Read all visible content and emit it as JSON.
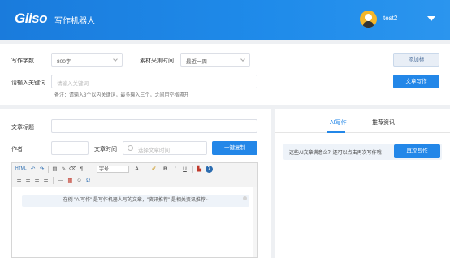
{
  "header": {
    "logo": "Giiso",
    "app_name": "写作机器人",
    "username": "test2"
  },
  "settings": {
    "word_count_label": "写作字数",
    "word_count_value": "800字",
    "time_label": "素材采集时间",
    "time_value": "最近一周",
    "keyword_label": "请输入关键词",
    "keyword_placeholder": "请输入关键词",
    "note": "备注：请输入3个以内关键词，最多输入三个，之间用空格隔开",
    "add_tag_button": "添加标",
    "write_button": "文章写作"
  },
  "article": {
    "title_label": "文章标题",
    "author_label": "作者",
    "time_label": "文章时间",
    "time_placeholder": "选择文章时间",
    "copy_button": "一键复制"
  },
  "toolbar": {
    "html": "HTML",
    "font_select": "字号",
    "font_a": "A",
    "bold": "B",
    "italic": "I",
    "underline": "U",
    "help": "?"
  },
  "editor": {
    "hint": "在例 \"AI写作\" 是写作机器人写的文章，\"资讯推荐\" 是相关资讯推荐~"
  },
  "right_panel": {
    "tab_ai": "AI写作",
    "tab_news": "推荐资讯",
    "rewrite_text": "这些AI文章满意么？还可以点击再次写作哦",
    "rewrite_button": "再次写作"
  }
}
